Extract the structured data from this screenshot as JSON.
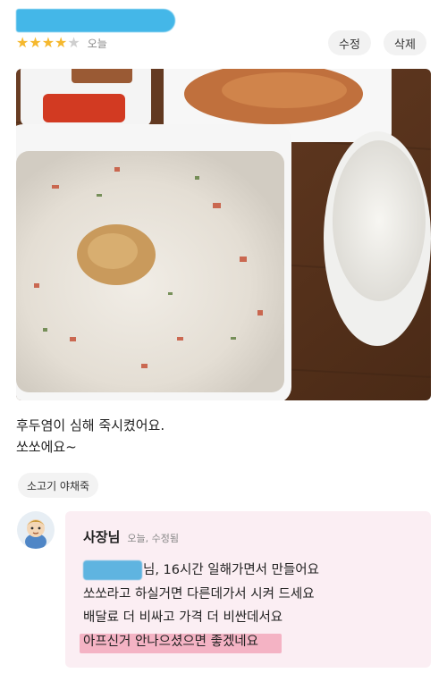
{
  "review": {
    "rating": 4,
    "max_rating": 5,
    "date": "오늘",
    "edit_label": "수정",
    "delete_label": "삭제",
    "text_line1": "후두염이 심해 죽시켰어요.",
    "text_line2": "쏘쏘에요~",
    "menu_tag": "소고기 야채죽"
  },
  "reply": {
    "author": "사장님",
    "meta": "오늘, 수정됨",
    "line1_suffix": "님, 16시간 일해가면서 만들어요",
    "line2": "쏘쏘라고 하실거면 다른데가서 시켜 드세요",
    "line3": "배달료 더 비싸고 가격 더 비싼데서요",
    "line4": "아프신거 안나으셨으면 좋겠네요"
  },
  "colors": {
    "star_on": "#f5b82e",
    "star_off": "#cfcfcf",
    "reply_bg": "#fbeef3",
    "highlight": "#f29fb4",
    "redaction": "#44b7e8"
  }
}
